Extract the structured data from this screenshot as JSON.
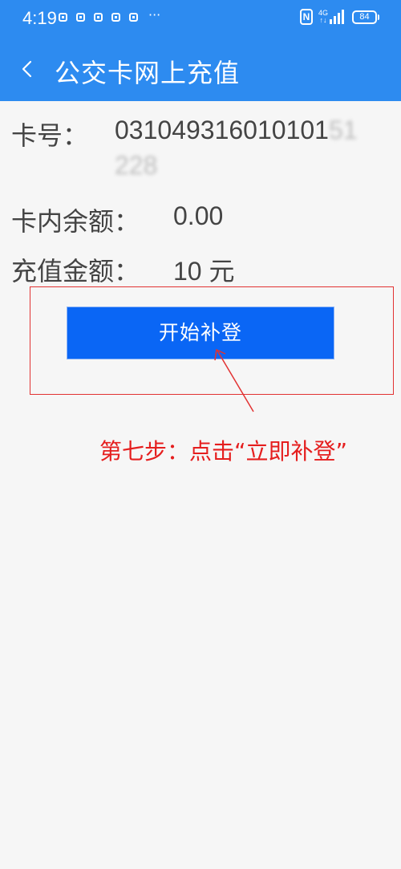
{
  "status_bar": {
    "time": "4:19",
    "more": "···",
    "nfc": "N",
    "network_top": "4G",
    "network_bottom": "↑↓",
    "battery": "84"
  },
  "app_bar": {
    "title": "公交卡网上充值",
    "back_icon": "chevron-left-icon"
  },
  "card": {
    "number_label": "卡号：",
    "number_line1": "031049316010101",
    "number_line1_blurred": "51",
    "number_line2_blurred": "228",
    "balance_label": "卡内余额：",
    "balance_value": "0.00",
    "amount_label": "充值金额：",
    "amount_value": "10 元"
  },
  "action": {
    "button_label": "开始补登"
  },
  "annotation": {
    "text": "第七步：点击“立即补登”",
    "color": "#e51e1e"
  },
  "colors": {
    "brand": "#2d8bf0",
    "button": "#0a66f5",
    "annotation_red": "#e23232"
  }
}
